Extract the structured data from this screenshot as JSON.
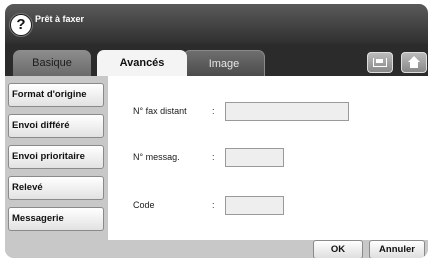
{
  "header": {
    "title": "Prêt à faxer",
    "help_icon": "?"
  },
  "tabs": [
    {
      "label": "Basique",
      "active": false
    },
    {
      "label": "Avancés",
      "active": true
    },
    {
      "label": "Image",
      "active": false
    }
  ],
  "toolbar_icons": [
    "tray-icon",
    "home-icon"
  ],
  "sidebar": {
    "items": [
      {
        "label": "Format d'origine"
      },
      {
        "label": "Envoi différé"
      },
      {
        "label": "Envoi prioritaire"
      },
      {
        "label": "Relevé"
      },
      {
        "label": "Messagerie"
      }
    ]
  },
  "form": {
    "fields": [
      {
        "label": "N° fax distant",
        "separator": ":",
        "value": ""
      },
      {
        "label": "N° messag.",
        "separator": ":",
        "value": ""
      },
      {
        "label": "Code",
        "separator": ":",
        "value": ""
      }
    ]
  },
  "footer": {
    "ok_label": "OK",
    "cancel_label": "Annuler"
  },
  "colors": {
    "titlebar": "#3f3f3f",
    "tab_active": "#f4f4f4",
    "panel": "#c9c9c9",
    "content_bg": "#ffffff"
  }
}
